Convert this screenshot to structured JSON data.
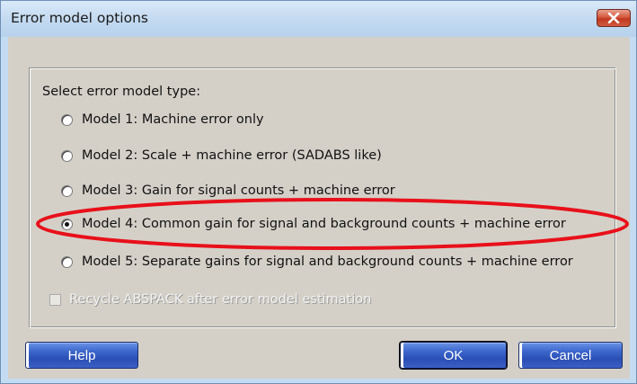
{
  "window": {
    "title": "Error model options",
    "close_icon": "close-x-icon"
  },
  "group": {
    "label": "Select error model type:"
  },
  "options": [
    {
      "label": "Model 1: Machine error only",
      "checked": false
    },
    {
      "label": "Model 2: Scale + machine error (SADABS like)",
      "checked": false
    },
    {
      "label": "Model 3: Gain for signal counts + machine error",
      "checked": false
    },
    {
      "label": "Model 4: Common gain for signal and background counts + machine error",
      "checked": true
    },
    {
      "label": "Model 5: Separate gains for signal and background counts + machine error",
      "checked": false
    }
  ],
  "recycle": {
    "label": "Recycle ABSPACK after error model estimation",
    "checked": false,
    "enabled": false
  },
  "buttons": {
    "help": "Help",
    "ok": "OK",
    "cancel": "Cancel"
  },
  "colors": {
    "annotation_ellipse": "#e8101a",
    "button_blue": "#2a4fb4",
    "close_red": "#c0381f"
  }
}
